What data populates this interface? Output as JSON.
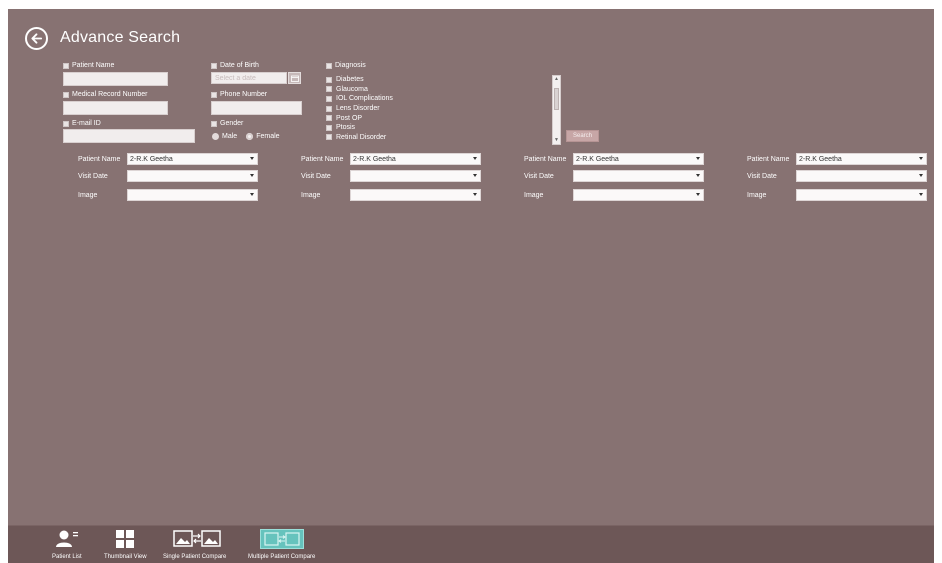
{
  "header": {
    "title": "Advance Search"
  },
  "search": {
    "patient_name": {
      "label": "Patient Name",
      "value": ""
    },
    "medical_record_number": {
      "label": "Medical Record Number",
      "value": ""
    },
    "email": {
      "label": "E-mail ID",
      "value": ""
    },
    "date_of_birth": {
      "label": "Date of Birth",
      "placeholder": "Select a date"
    },
    "phone_number": {
      "label": "Phone Number",
      "value": ""
    },
    "gender": {
      "label": "Gender",
      "options": [
        "Male",
        "Female"
      ]
    },
    "diagnosis": {
      "label": "Diagnosis",
      "items": [
        "Diabetes",
        "Glaucoma",
        "IOL Complications",
        "Lens Disorder",
        "Post OP",
        "Ptosis",
        "Retinal Disorder"
      ]
    },
    "search_button": "Search"
  },
  "compare_panels": [
    {
      "patient_label": "Patient Name",
      "patient_value": "2-R.K Geetha",
      "visit_label": "Visit Date",
      "visit_value": "",
      "image_label": "Image",
      "image_value": ""
    },
    {
      "patient_label": "Patient Name",
      "patient_value": "2-R.K Geetha",
      "visit_label": "Visit Date",
      "visit_value": "",
      "image_label": "Image",
      "image_value": ""
    },
    {
      "patient_label": "Patient Name",
      "patient_value": "2-R.K Geetha",
      "visit_label": "Visit Date",
      "visit_value": "",
      "image_label": "Image",
      "image_value": ""
    },
    {
      "patient_label": "Patient Name",
      "patient_value": "2-R.K Geetha",
      "visit_label": "Visit Date",
      "visit_value": "",
      "image_label": "Image",
      "image_value": ""
    }
  ],
  "bottom_nav": [
    {
      "label": "Patient List",
      "icon": "patient-list-icon"
    },
    {
      "label": "Thumbnail View",
      "icon": "thumbnail-view-icon"
    },
    {
      "label": "Single Patient Compare",
      "icon": "single-compare-icon"
    },
    {
      "label": "Multiple Patient Compare",
      "icon": "multiple-compare-icon",
      "active": true
    }
  ],
  "colors": {
    "background": "#877272",
    "bottom_bar": "#6d5757",
    "active_nav": "#66c3bd",
    "search_button": "#c7a6a6"
  }
}
